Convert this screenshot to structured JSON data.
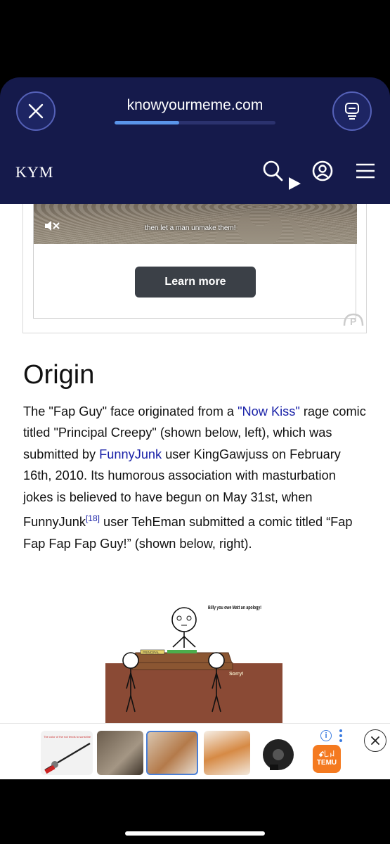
{
  "browser": {
    "url": "knowyourmeme.com",
    "load_progress": 0.4
  },
  "site": {
    "logo": "KYM"
  },
  "video_ad": {
    "caption": "then let a man unmake them!",
    "cta": "Learn more"
  },
  "article": {
    "heading": "Origin",
    "p1": "The \"Fap Guy\" face originated from a ",
    "link_now_kiss": "\"Now Kiss\"",
    "p2": " rage comic titled \"Principal Creepy\" (shown below, left), which was submitted by ",
    "link_funnyjunk": "FunnyJunk",
    "p3": " user KingGawjuss on February 16th, 2010. Its humorous association with masturbation jokes is believed to have begun on May 31st, when FunnyJunk",
    "ref": "[18]",
    "p4": " user TehEman submitted a comic titled “Fap Fap Fap Fap Guy!” (shown below, right)."
  },
  "comic": {
    "speech": "Billy you owe Matt an apology!",
    "nameplate": "PRINCIPAL",
    "reply": "Sorry!"
  },
  "bottom_ad": {
    "thumb1_text": "The color of the rod tends to sunshine",
    "brand": "TEMU",
    "brand_glyph": "ꗃ꒒ꈤ"
  },
  "colors": {
    "browser_bar": "#151a4b",
    "link": "#1a22a8",
    "progress": "#5a95ea"
  }
}
